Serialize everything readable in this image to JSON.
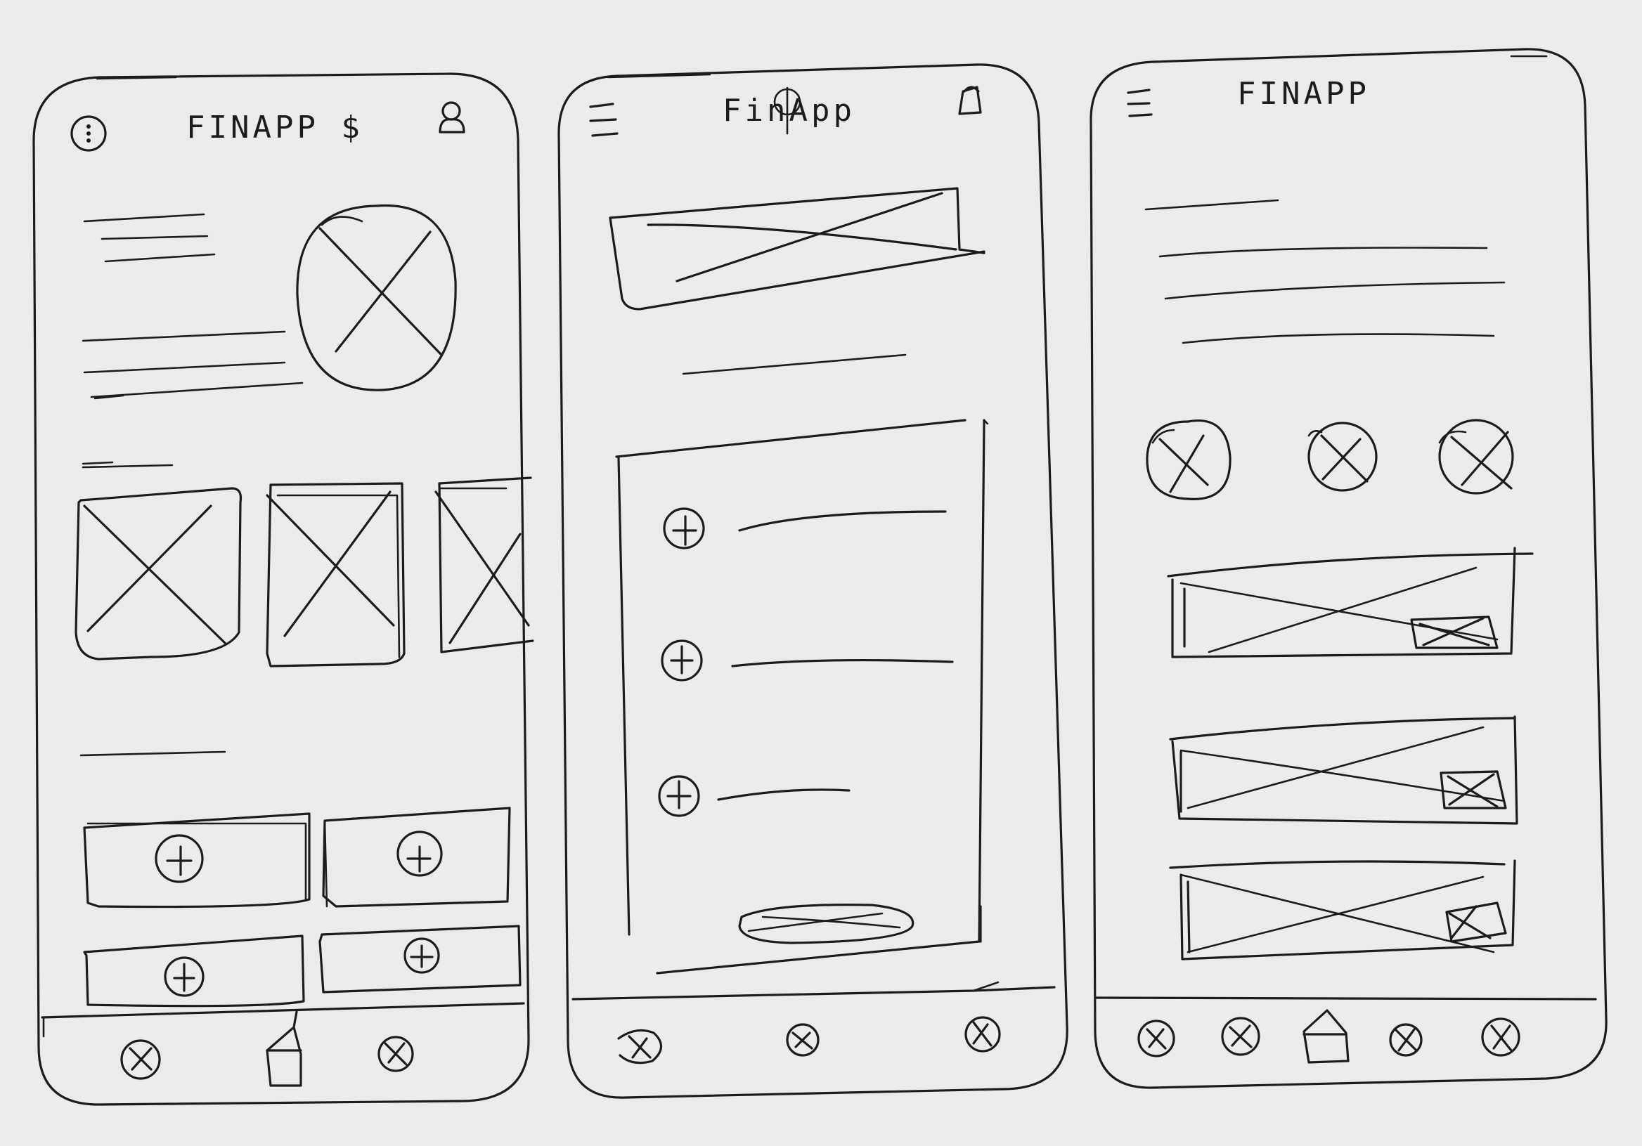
{
  "screens": [
    {
      "title": "FINAPP $"
    },
    {
      "title": "FinApp"
    },
    {
      "title": "FINAPP"
    }
  ],
  "colors": {
    "paper": "#ebebeb",
    "ink": "#1c1c1c"
  },
  "icons": {
    "screen1_header_left": "menu-circle-icon",
    "screen1_header_right": "user-icon",
    "screen2_header_left": "hamburger-icon",
    "screen2_header_right": "user-icon",
    "screen3_header_left": "hamburger-icon",
    "list_item": "plus-circle-icon",
    "nav_home": "home-icon",
    "placeholder": "image-placeholder-icon"
  }
}
